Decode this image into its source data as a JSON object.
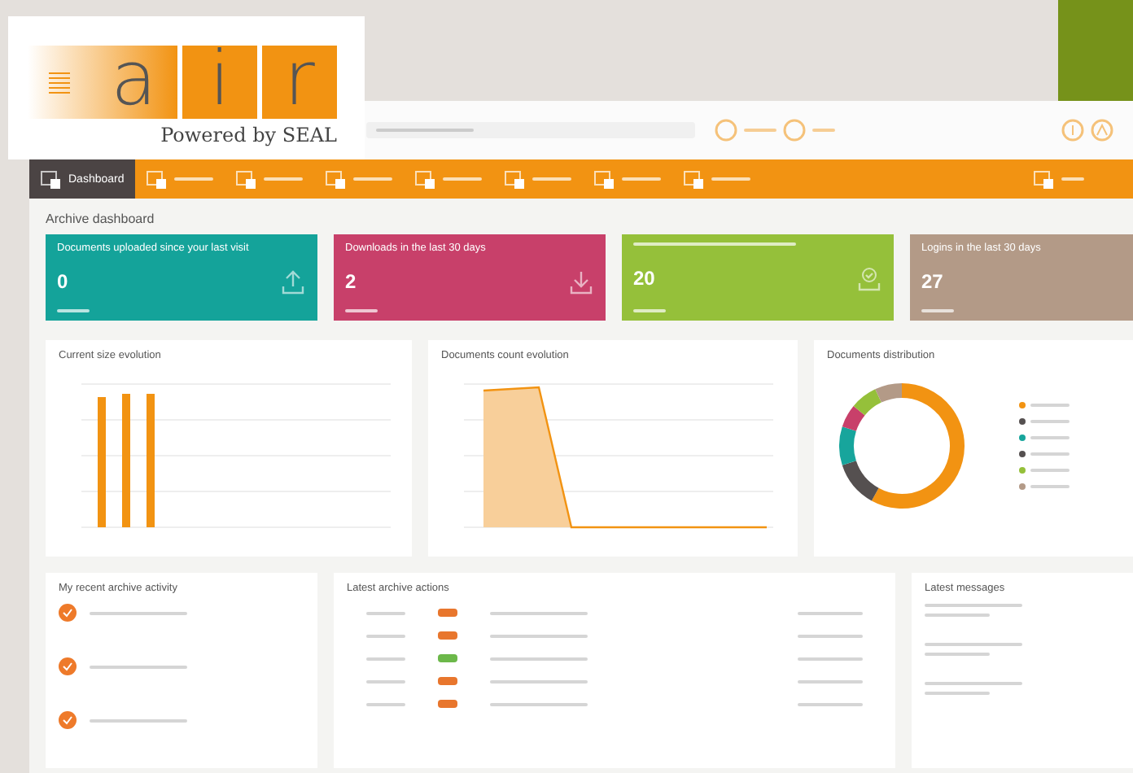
{
  "logo": {
    "letters": [
      "a",
      "i",
      "r"
    ],
    "tagline": "Powered by SEAL"
  },
  "nav": [
    {
      "label": "Dashboard",
      "selected": true
    },
    {
      "selected": false
    },
    {
      "selected": false
    },
    {
      "selected": false
    },
    {
      "selected": false
    },
    {
      "selected": false
    },
    {
      "selected": false
    },
    {
      "selected": false
    }
  ],
  "page_title": "Archive dashboard",
  "cards": [
    {
      "title": "Documents uploaded since your last visit",
      "value": "0",
      "color": "#14a39a",
      "kind": "upload"
    },
    {
      "title": "Downloads in the last 30 days",
      "value": "2",
      "color": "#c8406a",
      "kind": "download"
    },
    {
      "value": "20",
      "color": "#95c03a",
      "kind": "check"
    },
    {
      "title": "Logins in the last 30 days",
      "value": "27",
      "color": "#b39a87",
      "kind": "plain"
    }
  ],
  "charts": [
    {
      "kind": "bar",
      "title": "Current size evolution"
    },
    {
      "kind": "area",
      "title": "Documents count evolution"
    },
    {
      "kind": "donut",
      "title": "Documents distribution"
    }
  ],
  "activity": {
    "title": "My recent archive activity"
  },
  "actions": {
    "title": "Latest archive actions",
    "rows": [
      {
        "color": "#e8762d"
      },
      {
        "color": "#e8762d"
      },
      {
        "color": "#6cb84a"
      },
      {
        "color": "#e8762d"
      },
      {
        "color": "#e8762d"
      }
    ]
  },
  "messages": {
    "title": "Latest messages"
  }
}
